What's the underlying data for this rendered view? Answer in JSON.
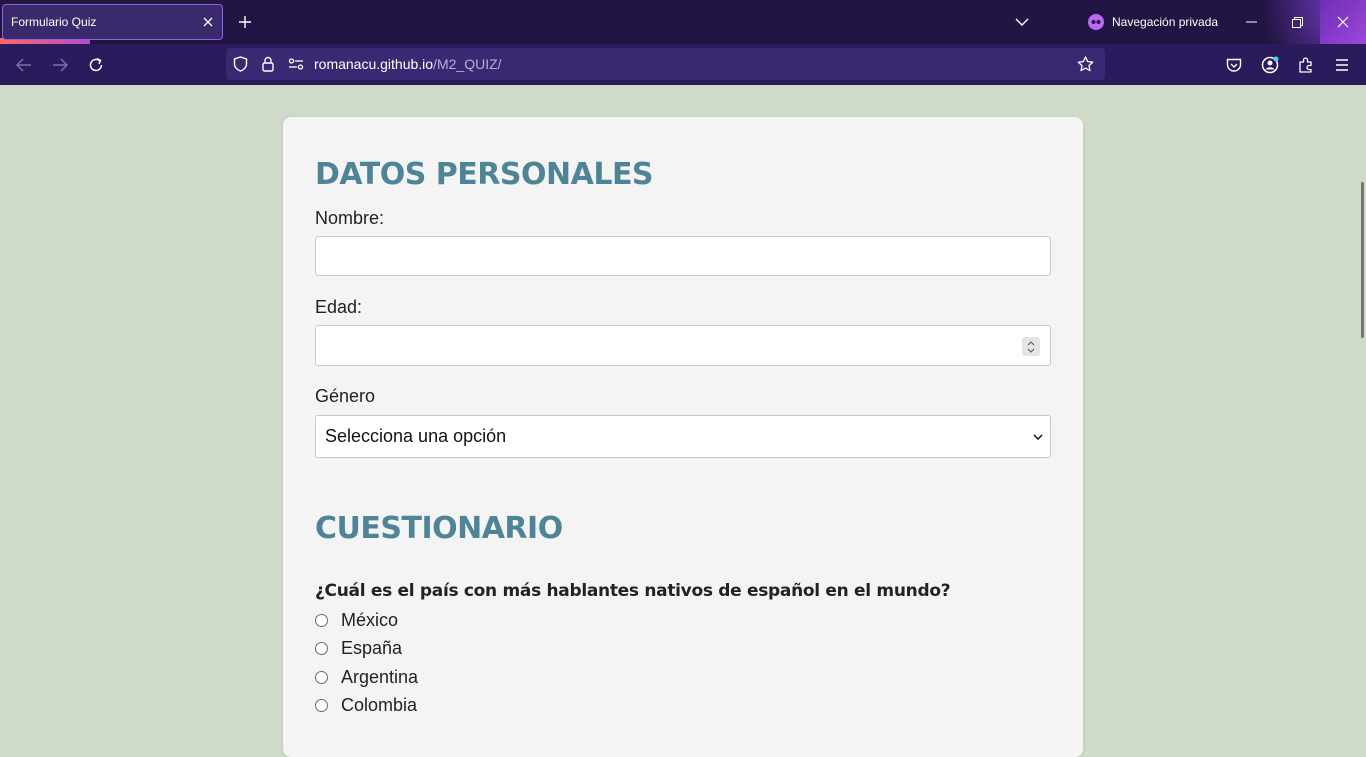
{
  "browser": {
    "tab_title": "Formulario Quiz",
    "private_label": "Navegación privada",
    "url_domain": "romanacu.github.io",
    "url_path": "/M2_QUIZ/",
    "icons": [
      "close-icon",
      "plus-icon",
      "chevron-down-icon",
      "private-mask-icon",
      "minimize-icon",
      "restore-icon",
      "close-window-icon",
      "back-arrow-icon",
      "forward-arrow-icon",
      "reload-icon",
      "shield-icon",
      "lock-icon",
      "permissions-icon",
      "star-icon",
      "pocket-icon",
      "account-icon",
      "extensions-icon",
      "hamburger-menu-icon"
    ],
    "colors": {
      "titlebar": "#221543",
      "navbar": "#2b1a5c",
      "urlbar": "#3a2872",
      "page_background": "#d0dac8",
      "card_background": "#f4f4f4",
      "heading": "#4f8496"
    }
  },
  "form": {
    "personal_title": "DATOS PERSONALES",
    "name_label": "Nombre:",
    "name_value": "",
    "age_label": "Edad:",
    "age_value": "",
    "gender_label": "Género",
    "gender_selected": "Selecciona una opción"
  },
  "quiz": {
    "title": "CUESTIONARIO",
    "question": "¿Cuál es el país con más hablantes nativos de español en el mundo?",
    "options": [
      "México",
      "España",
      "Argentina",
      "Colombia"
    ]
  }
}
